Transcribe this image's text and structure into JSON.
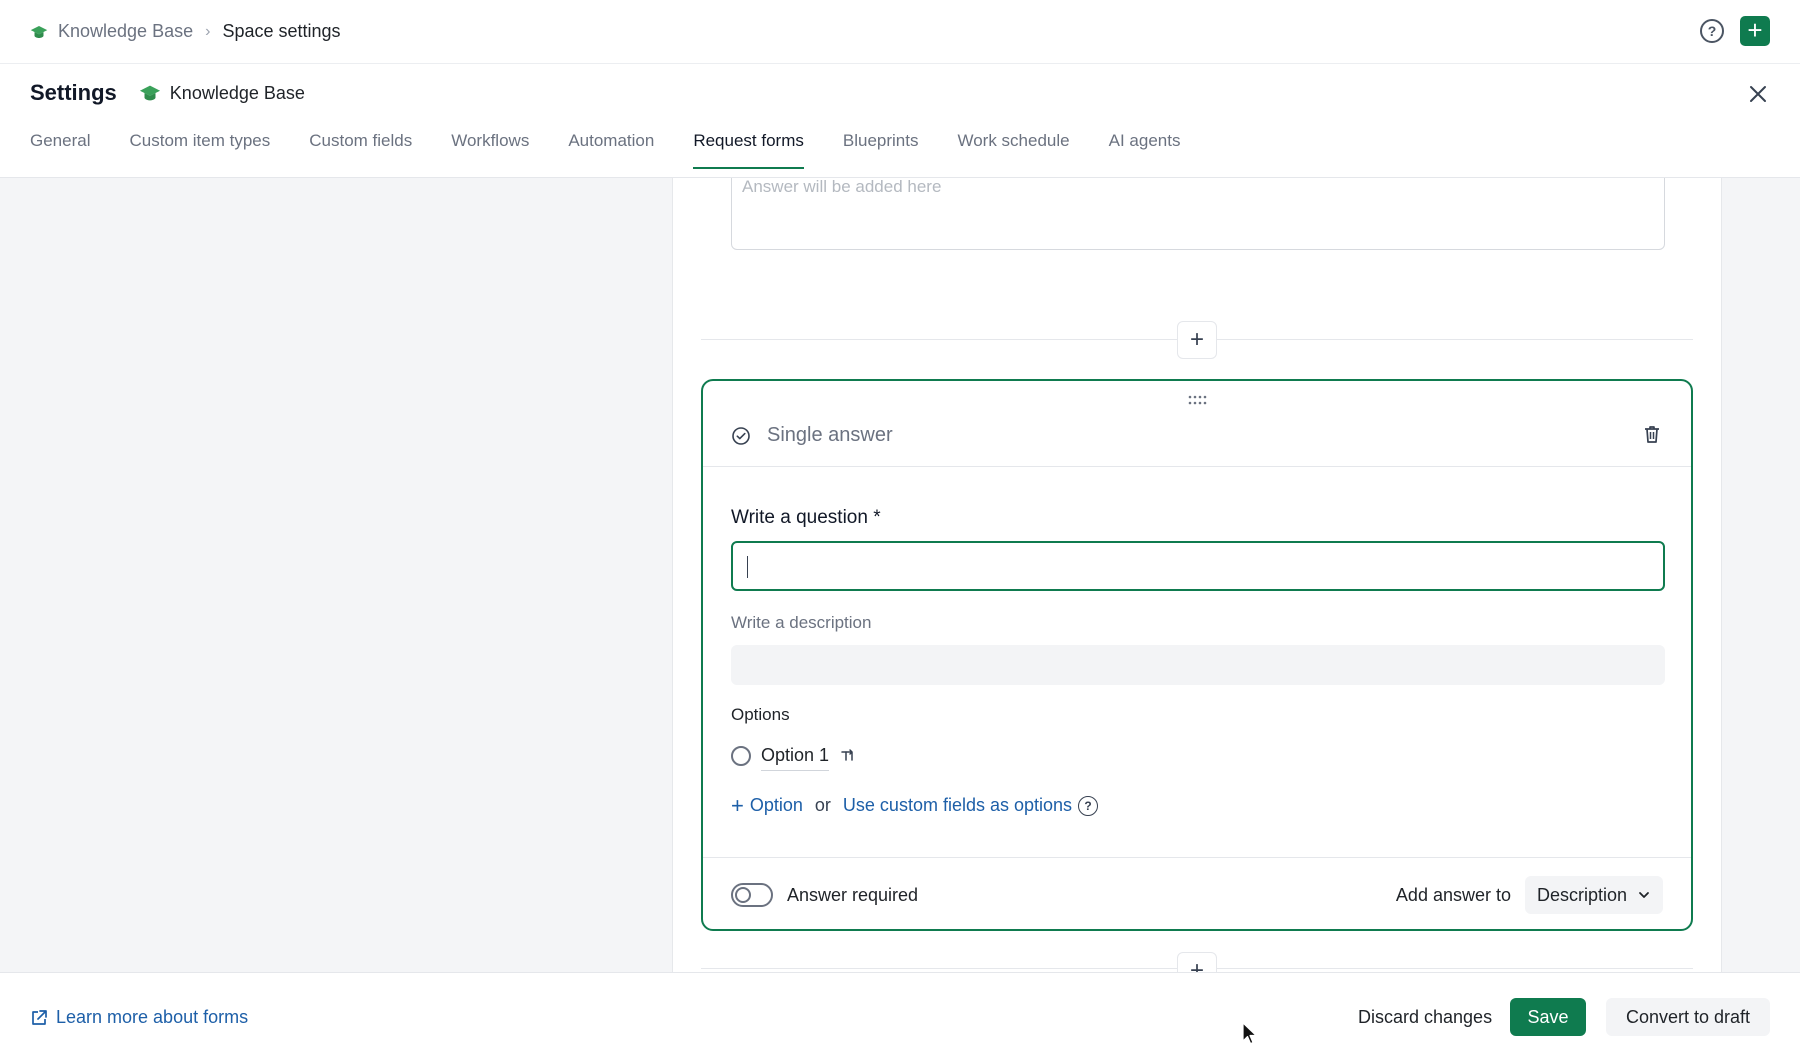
{
  "breadcrumb": {
    "root": "Knowledge Base",
    "separator": "›",
    "current": "Space settings"
  },
  "topbar": {
    "help_glyph": "?",
    "add_glyph": "+"
  },
  "settings": {
    "title": "Settings",
    "space_name": "Knowledge Base"
  },
  "tabs": [
    {
      "label": "General",
      "active": false
    },
    {
      "label": "Custom item types",
      "active": false
    },
    {
      "label": "Custom fields",
      "active": false
    },
    {
      "label": "Workflows",
      "active": false
    },
    {
      "label": "Automation",
      "active": false
    },
    {
      "label": "Request forms",
      "active": true
    },
    {
      "label": "Blueprints",
      "active": false
    },
    {
      "label": "Work schedule",
      "active": false
    },
    {
      "label": "AI agents",
      "active": false
    }
  ],
  "previous_field": {
    "placeholder": "Answer will be added here"
  },
  "insert_glyph": "+",
  "question_card": {
    "type_label": "Single answer",
    "question_label": "Write a question *",
    "question_value": "",
    "description_label": "Write a description",
    "description_value": "",
    "options_label": "Options",
    "options": [
      {
        "label": "Option 1"
      }
    ],
    "add_option_plus": "+",
    "add_option_label": "Option",
    "or_text": "or",
    "custom_fields_link": "Use custom fields as options",
    "help_glyph": "?",
    "answer_required_label": "Answer required",
    "answer_required": false,
    "add_answer_to_label": "Add answer to",
    "add_answer_to_value": "Description"
  },
  "footer": {
    "learn_more": "Learn more about forms",
    "discard": "Discard changes",
    "save": "Save",
    "convert": "Convert to draft"
  },
  "colors": {
    "accent": "#0f7b4f",
    "link": "#1d5fa8",
    "muted": "#6b7280",
    "background": "#f4f5f7"
  },
  "icons": [
    "graduation-cap-icon",
    "chevron-right-icon",
    "help-icon",
    "plus-icon",
    "close-icon",
    "drag-handle-icon",
    "check-circle-icon",
    "trash-icon",
    "branch-icon",
    "chevron-down-icon",
    "external-link-icon"
  ]
}
